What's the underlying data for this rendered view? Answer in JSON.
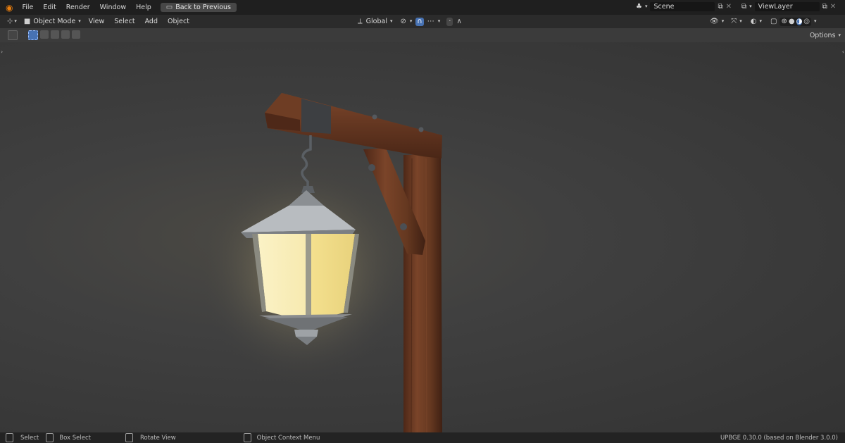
{
  "topbar": {
    "menus": [
      "File",
      "Edit",
      "Render",
      "Window",
      "Help"
    ],
    "back_button": "Back to Previous",
    "scene_label": "Scene",
    "view_layer_label": "ViewLayer"
  },
  "header": {
    "mode": "Object Mode",
    "menus": [
      "View",
      "Select",
      "Add",
      "Object"
    ],
    "orientation": "Global",
    "options": "Options"
  },
  "statusbar": {
    "select": "Select",
    "box_select": "Box Select",
    "rotate_view": "Rotate View",
    "context_menu": "Object Context Menu",
    "version": "UPBGE 0.30.0 (based on Blender 3.0.0)"
  },
  "colors": {
    "lamp_glow": "#f6e7a8",
    "wood": "#6a3a24",
    "selection_blue": "#4772b3"
  }
}
